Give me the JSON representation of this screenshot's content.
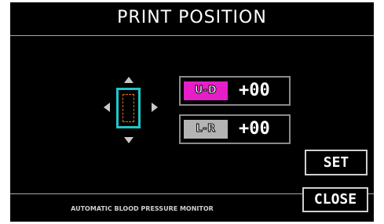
{
  "header": {
    "title": "PRINT POSITION"
  },
  "direction_pad": {
    "icons": [
      "arrow-up-icon",
      "arrow-down-icon",
      "arrow-left-icon",
      "arrow-right-icon"
    ],
    "frame_color": "#21c6c6",
    "guide_color": "#e06a2a"
  },
  "settings": {
    "ud": {
      "label": "U-D",
      "value": "+00",
      "color": "#e61ec8"
    },
    "lr": {
      "label": "L-R",
      "value": "+00",
      "color": "#b4b4b4"
    }
  },
  "buttons": {
    "set_label": "SET",
    "close_label": "CLOSE"
  },
  "footer": {
    "text": "AUTOMATIC BLOOD PRESSURE MONITOR"
  }
}
